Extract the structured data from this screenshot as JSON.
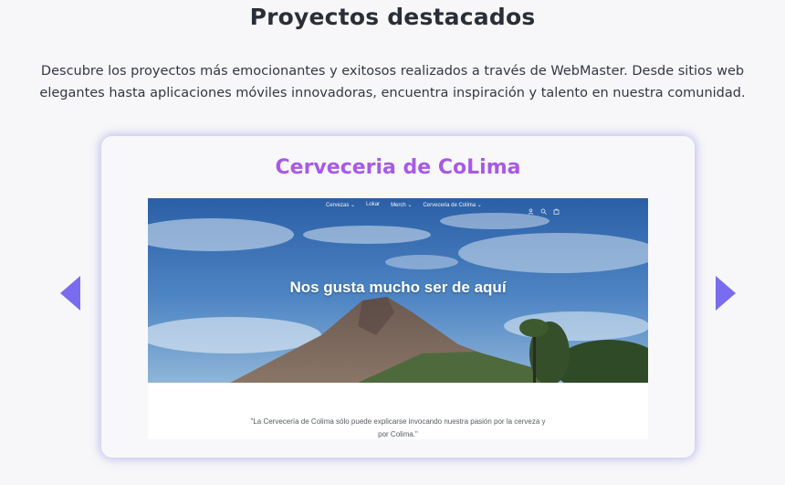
{
  "section": {
    "title": "Proyectos destacados",
    "description": "Descubre los proyectos más emocionantes y exitosos realizados a través de WebMaster. Desde sitios web elegantes hasta aplicaciones móviles innovadoras, encuentra inspiración y talento en nuestra comunidad."
  },
  "carousel": {
    "prev_icon": "triangle-left-icon",
    "next_icon": "triangle-right-icon",
    "accent_color": "#7a6cf0",
    "project": {
      "title": "Cerveceria de CoLima",
      "title_color": "#a75ae8",
      "screenshot": {
        "nav": [
          "Cervezas ⌄",
          "Lokar",
          "Merch ⌄",
          "Cerveceria de Colima ⌄"
        ],
        "icons": [
          "user-icon",
          "search-icon",
          "bag-icon"
        ],
        "hero_heading": "Nos gusta mucho ser de aquí",
        "quote": "\"La Cervecería de Colima sólo puede explicarse invocando nuestra pasión por la cerveza y por Colima.\""
      }
    }
  }
}
